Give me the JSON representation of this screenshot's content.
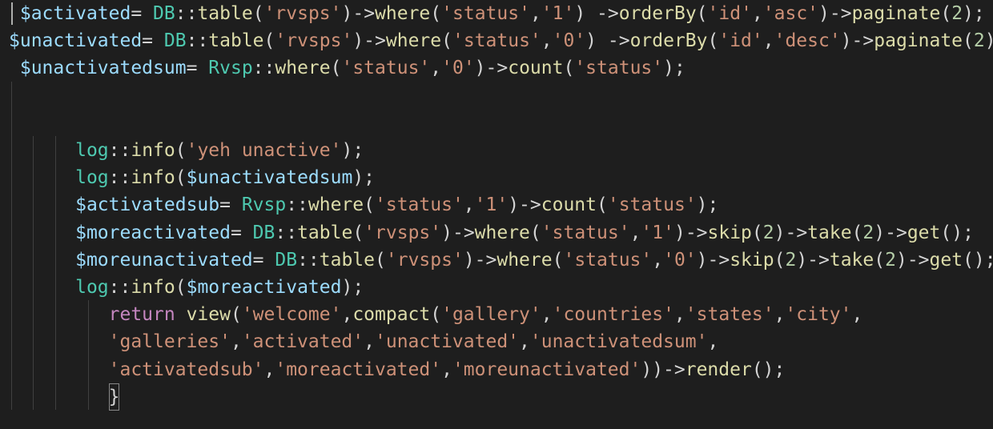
{
  "editor": {
    "theme_colors": {
      "background": "#1e1e1e",
      "variable": "#9cdcfe",
      "class": "#4ec9b0",
      "string": "#ce9178",
      "function": "#dcdcaa",
      "keyword": "#c586c0",
      "number": "#b5cea8",
      "punctuation": "#d4d4d4"
    },
    "lines": [
      {
        "indent": " ",
        "tokens": [
          {
            "t": "$activated",
            "c": "var"
          },
          {
            "t": "= ",
            "c": "punc"
          },
          {
            "t": "DB",
            "c": "cls"
          },
          {
            "t": "::",
            "c": "punc"
          },
          {
            "t": "table",
            "c": "fn"
          },
          {
            "t": "(",
            "c": "punc"
          },
          {
            "t": "'rvsps'",
            "c": "str"
          },
          {
            "t": ")->",
            "c": "punc"
          },
          {
            "t": "where",
            "c": "fn"
          },
          {
            "t": "(",
            "c": "punc"
          },
          {
            "t": "'status'",
            "c": "str"
          },
          {
            "t": ",",
            "c": "punc"
          },
          {
            "t": "'1'",
            "c": "str"
          },
          {
            "t": ") ->",
            "c": "punc"
          },
          {
            "t": "orderBy",
            "c": "fn"
          },
          {
            "t": "(",
            "c": "punc"
          },
          {
            "t": "'id'",
            "c": "str"
          },
          {
            "t": ",",
            "c": "punc"
          },
          {
            "t": "'asc'",
            "c": "str"
          },
          {
            "t": ")->",
            "c": "punc"
          },
          {
            "t": "paginate",
            "c": "fn"
          },
          {
            "t": "(",
            "c": "punc"
          },
          {
            "t": "2",
            "c": "num"
          },
          {
            "t": ");",
            "c": "punc"
          }
        ]
      },
      {
        "indent": "",
        "tokens": [
          {
            "t": "$unactivated",
            "c": "var"
          },
          {
            "t": "= ",
            "c": "punc"
          },
          {
            "t": "DB",
            "c": "cls"
          },
          {
            "t": "::",
            "c": "punc"
          },
          {
            "t": "table",
            "c": "fn"
          },
          {
            "t": "(",
            "c": "punc"
          },
          {
            "t": "'rvsps'",
            "c": "str"
          },
          {
            "t": ")->",
            "c": "punc"
          },
          {
            "t": "where",
            "c": "fn"
          },
          {
            "t": "(",
            "c": "punc"
          },
          {
            "t": "'status'",
            "c": "str"
          },
          {
            "t": ",",
            "c": "punc"
          },
          {
            "t": "'0'",
            "c": "str"
          },
          {
            "t": ") ->",
            "c": "punc"
          },
          {
            "t": "orderBy",
            "c": "fn"
          },
          {
            "t": "(",
            "c": "punc"
          },
          {
            "t": "'id'",
            "c": "str"
          },
          {
            "t": ",",
            "c": "punc"
          },
          {
            "t": "'desc'",
            "c": "str"
          },
          {
            "t": ")->",
            "c": "punc"
          },
          {
            "t": "paginate",
            "c": "fn"
          },
          {
            "t": "(",
            "c": "punc"
          },
          {
            "t": "2",
            "c": "num"
          },
          {
            "t": ")",
            "c": "punc"
          }
        ]
      },
      {
        "indent": " ",
        "tokens": [
          {
            "t": "$unactivatedsum",
            "c": "var"
          },
          {
            "t": "= ",
            "c": "punc"
          },
          {
            "t": "Rvsp",
            "c": "cls"
          },
          {
            "t": "::",
            "c": "punc"
          },
          {
            "t": "where",
            "c": "fn"
          },
          {
            "t": "(",
            "c": "punc"
          },
          {
            "t": "'status'",
            "c": "str"
          },
          {
            "t": ",",
            "c": "punc"
          },
          {
            "t": "'0'",
            "c": "str"
          },
          {
            "t": ")->",
            "c": "punc"
          },
          {
            "t": "count",
            "c": "fn"
          },
          {
            "t": "(",
            "c": "punc"
          },
          {
            "t": "'status'",
            "c": "str"
          },
          {
            "t": ");",
            "c": "punc"
          }
        ]
      },
      {
        "indent": "",
        "tokens": []
      },
      {
        "indent": "",
        "tokens": []
      },
      {
        "indent": "      ",
        "tokens": [
          {
            "t": "log",
            "c": "cls"
          },
          {
            "t": "::",
            "c": "punc"
          },
          {
            "t": "info",
            "c": "fn"
          },
          {
            "t": "(",
            "c": "punc"
          },
          {
            "t": "'yeh unactive'",
            "c": "str"
          },
          {
            "t": ");",
            "c": "punc"
          }
        ]
      },
      {
        "indent": "      ",
        "tokens": [
          {
            "t": "log",
            "c": "cls"
          },
          {
            "t": "::",
            "c": "punc"
          },
          {
            "t": "info",
            "c": "fn"
          },
          {
            "t": "(",
            "c": "punc"
          },
          {
            "t": "$unactivatedsum",
            "c": "var"
          },
          {
            "t": ");",
            "c": "punc"
          }
        ]
      },
      {
        "indent": "      ",
        "tokens": [
          {
            "t": "$activatedsub",
            "c": "var"
          },
          {
            "t": "= ",
            "c": "punc"
          },
          {
            "t": "Rvsp",
            "c": "cls"
          },
          {
            "t": "::",
            "c": "punc"
          },
          {
            "t": "where",
            "c": "fn"
          },
          {
            "t": "(",
            "c": "punc"
          },
          {
            "t": "'status'",
            "c": "str"
          },
          {
            "t": ",",
            "c": "punc"
          },
          {
            "t": "'1'",
            "c": "str"
          },
          {
            "t": ")->",
            "c": "punc"
          },
          {
            "t": "count",
            "c": "fn"
          },
          {
            "t": "(",
            "c": "punc"
          },
          {
            "t": "'status'",
            "c": "str"
          },
          {
            "t": ");",
            "c": "punc"
          }
        ]
      },
      {
        "indent": "      ",
        "tokens": [
          {
            "t": "$moreactivated",
            "c": "var"
          },
          {
            "t": "= ",
            "c": "punc"
          },
          {
            "t": "DB",
            "c": "cls"
          },
          {
            "t": "::",
            "c": "punc"
          },
          {
            "t": "table",
            "c": "fn"
          },
          {
            "t": "(",
            "c": "punc"
          },
          {
            "t": "'rvsps'",
            "c": "str"
          },
          {
            "t": ")->",
            "c": "punc"
          },
          {
            "t": "where",
            "c": "fn"
          },
          {
            "t": "(",
            "c": "punc"
          },
          {
            "t": "'status'",
            "c": "str"
          },
          {
            "t": ",",
            "c": "punc"
          },
          {
            "t": "'1'",
            "c": "str"
          },
          {
            "t": ")->",
            "c": "punc"
          },
          {
            "t": "skip",
            "c": "fn"
          },
          {
            "t": "(",
            "c": "punc"
          },
          {
            "t": "2",
            "c": "num"
          },
          {
            "t": ")->",
            "c": "punc"
          },
          {
            "t": "take",
            "c": "fn"
          },
          {
            "t": "(",
            "c": "punc"
          },
          {
            "t": "2",
            "c": "num"
          },
          {
            "t": ")->",
            "c": "punc"
          },
          {
            "t": "get",
            "c": "fn"
          },
          {
            "t": "();",
            "c": "punc"
          }
        ]
      },
      {
        "indent": "      ",
        "tokens": [
          {
            "t": "$moreunactivated",
            "c": "var"
          },
          {
            "t": "= ",
            "c": "punc"
          },
          {
            "t": "DB",
            "c": "cls"
          },
          {
            "t": "::",
            "c": "punc"
          },
          {
            "t": "table",
            "c": "fn"
          },
          {
            "t": "(",
            "c": "punc"
          },
          {
            "t": "'rvsps'",
            "c": "str"
          },
          {
            "t": ")->",
            "c": "punc"
          },
          {
            "t": "where",
            "c": "fn"
          },
          {
            "t": "(",
            "c": "punc"
          },
          {
            "t": "'status'",
            "c": "str"
          },
          {
            "t": ",",
            "c": "punc"
          },
          {
            "t": "'0'",
            "c": "str"
          },
          {
            "t": ")->",
            "c": "punc"
          },
          {
            "t": "skip",
            "c": "fn"
          },
          {
            "t": "(",
            "c": "punc"
          },
          {
            "t": "2",
            "c": "num"
          },
          {
            "t": ")->",
            "c": "punc"
          },
          {
            "t": "take",
            "c": "fn"
          },
          {
            "t": "(",
            "c": "punc"
          },
          {
            "t": "2",
            "c": "num"
          },
          {
            "t": ")->",
            "c": "punc"
          },
          {
            "t": "get",
            "c": "fn"
          },
          {
            "t": "();",
            "c": "punc"
          }
        ]
      },
      {
        "indent": "      ",
        "tokens": [
          {
            "t": "log",
            "c": "cls"
          },
          {
            "t": "::",
            "c": "punc"
          },
          {
            "t": "info",
            "c": "fn"
          },
          {
            "t": "(",
            "c": "punc"
          },
          {
            "t": "$moreactivated",
            "c": "var"
          },
          {
            "t": ");",
            "c": "punc"
          }
        ]
      },
      {
        "indent": "         ",
        "tokens": [
          {
            "t": "return",
            "c": "kw"
          },
          {
            "t": " ",
            "c": "punc"
          },
          {
            "t": "view",
            "c": "fn"
          },
          {
            "t": "(",
            "c": "punc"
          },
          {
            "t": "'welcome'",
            "c": "str"
          },
          {
            "t": ",",
            "c": "punc"
          },
          {
            "t": "compact",
            "c": "fn"
          },
          {
            "t": "(",
            "c": "punc"
          },
          {
            "t": "'gallery'",
            "c": "str"
          },
          {
            "t": ",",
            "c": "punc"
          },
          {
            "t": "'countries'",
            "c": "str"
          },
          {
            "t": ",",
            "c": "punc"
          },
          {
            "t": "'states'",
            "c": "str"
          },
          {
            "t": ",",
            "c": "punc"
          },
          {
            "t": "'city'",
            "c": "str"
          },
          {
            "t": ",",
            "c": "punc"
          }
        ]
      },
      {
        "indent": "         ",
        "tokens": [
          {
            "t": "'galleries'",
            "c": "str"
          },
          {
            "t": ",",
            "c": "punc"
          },
          {
            "t": "'activated'",
            "c": "str"
          },
          {
            "t": ",",
            "c": "punc"
          },
          {
            "t": "'unactivated'",
            "c": "str"
          },
          {
            "t": ",",
            "c": "punc"
          },
          {
            "t": "'unactivatedsum'",
            "c": "str"
          },
          {
            "t": ",",
            "c": "punc"
          }
        ]
      },
      {
        "indent": "         ",
        "tokens": [
          {
            "t": "'activatedsub'",
            "c": "str"
          },
          {
            "t": ",",
            "c": "punc"
          },
          {
            "t": "'moreactivated'",
            "c": "str"
          },
          {
            "t": ",",
            "c": "punc"
          },
          {
            "t": "'moreunactivated'",
            "c": "str"
          },
          {
            "t": "))->",
            "c": "punc"
          },
          {
            "t": "render",
            "c": "fn"
          },
          {
            "t": "();",
            "c": "punc"
          }
        ]
      },
      {
        "indent": "         ",
        "tokens": [
          {
            "t": "}",
            "c": "punc",
            "boxed": true
          }
        ]
      }
    ]
  }
}
